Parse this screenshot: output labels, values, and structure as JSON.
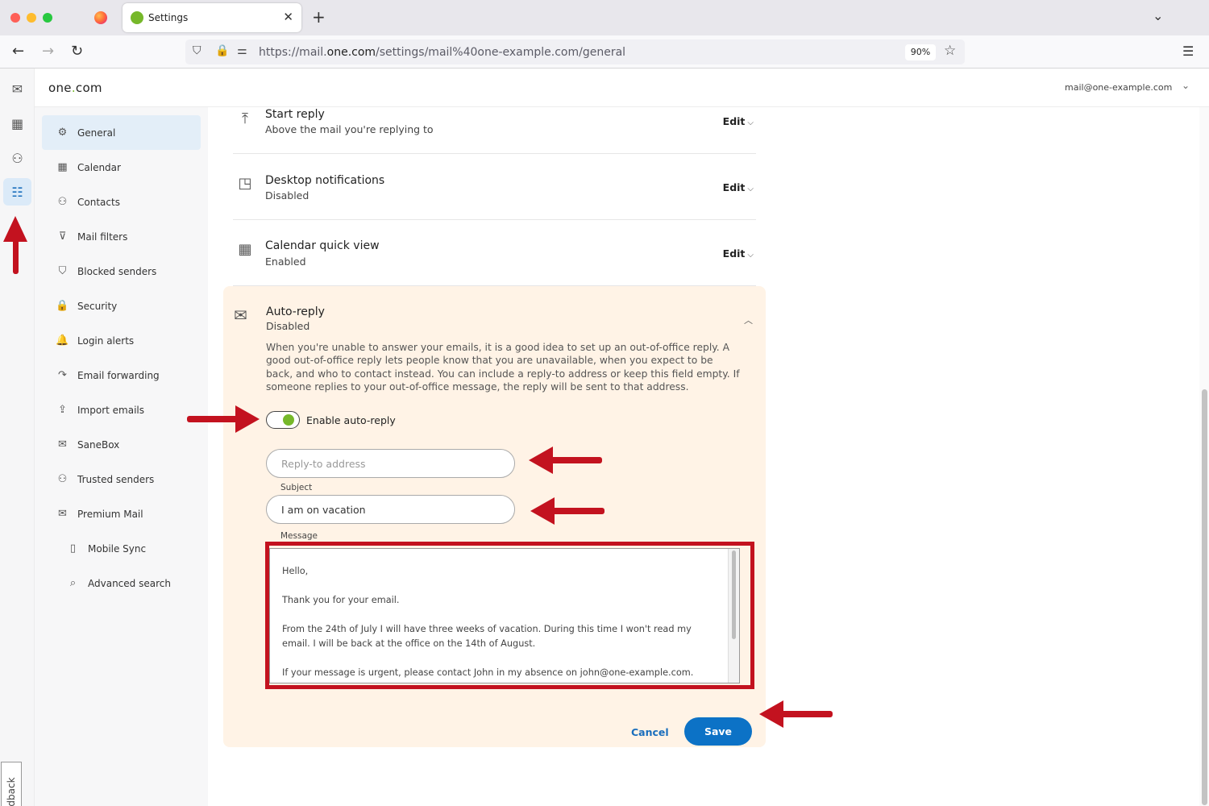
{
  "browser": {
    "tab_title": "Settings",
    "tab_close": "✕",
    "new_tab": "+",
    "url_prefix": "https://mail.",
    "url_host": "one.com",
    "url_path": "/settings/mail%40one-example.com/general",
    "zoom": "90%"
  },
  "app": {
    "logo_main": "one",
    "logo_dot": ".",
    "logo_suffix": "com",
    "account": "mail@one-example.com",
    "feedback": "Feedback"
  },
  "sidebar": {
    "items": [
      {
        "label": "General",
        "icon": "⚙"
      },
      {
        "label": "Calendar",
        "icon": "▦"
      },
      {
        "label": "Contacts",
        "icon": "⚇"
      },
      {
        "label": "Mail filters",
        "icon": "⊽"
      },
      {
        "label": "Blocked senders",
        "icon": "⛉"
      },
      {
        "label": "Security",
        "icon": "🔒"
      },
      {
        "label": "Login alerts",
        "icon": "🔔"
      },
      {
        "label": "Email forwarding",
        "icon": "↷"
      },
      {
        "label": "Import emails",
        "icon": "⇪"
      },
      {
        "label": "SaneBox",
        "icon": "✉"
      },
      {
        "label": "Trusted senders",
        "icon": "⚇"
      },
      {
        "label": "Premium Mail",
        "icon": "✉"
      },
      {
        "label": "Mobile Sync",
        "icon": "▯"
      },
      {
        "label": "Advanced search",
        "icon": "⌕"
      }
    ]
  },
  "settings": {
    "start_reply": {
      "title": "Start reply",
      "sub": "Above the mail you're replying to",
      "edit": "Edit"
    },
    "desktop_notifications": {
      "title": "Desktop notifications",
      "sub": "Disabled",
      "edit": "Edit"
    },
    "calendar_quick_view": {
      "title": "Calendar quick view",
      "sub": "Enabled",
      "edit": "Edit"
    }
  },
  "auto_reply": {
    "title": "Auto-reply",
    "status": "Disabled",
    "description": "When you're unable to answer your emails, it is a good idea to set up an out-of-office reply. A good out-of-office reply lets people know that you are unavailable, when you expect to be back, and who to contact instead. You can include a reply-to address or keep this field empty. If someone replies to your out-of-office message, the reply will be sent to that address.",
    "toggle_label": "Enable auto-reply",
    "reply_to_placeholder": "Reply-to address",
    "subject_label": "Subject",
    "subject_value": "I am on vacation",
    "message_label": "Message",
    "message_lines": [
      "Hello,",
      "Thank you for your email.",
      "From the 24th of July I will have three weeks of vacation. During this time I won't read my",
      "email. I will be back at the office on the 14th of August.",
      "If your message is urgent, please contact John in my absence on john@one-example.com."
    ],
    "cancel": "Cancel",
    "save": "Save"
  },
  "colors": {
    "accent_green": "#76b82a",
    "primary_blue": "#0c72c6",
    "panel_bg": "#fff3e6",
    "annotation_red": "#c3121f"
  }
}
